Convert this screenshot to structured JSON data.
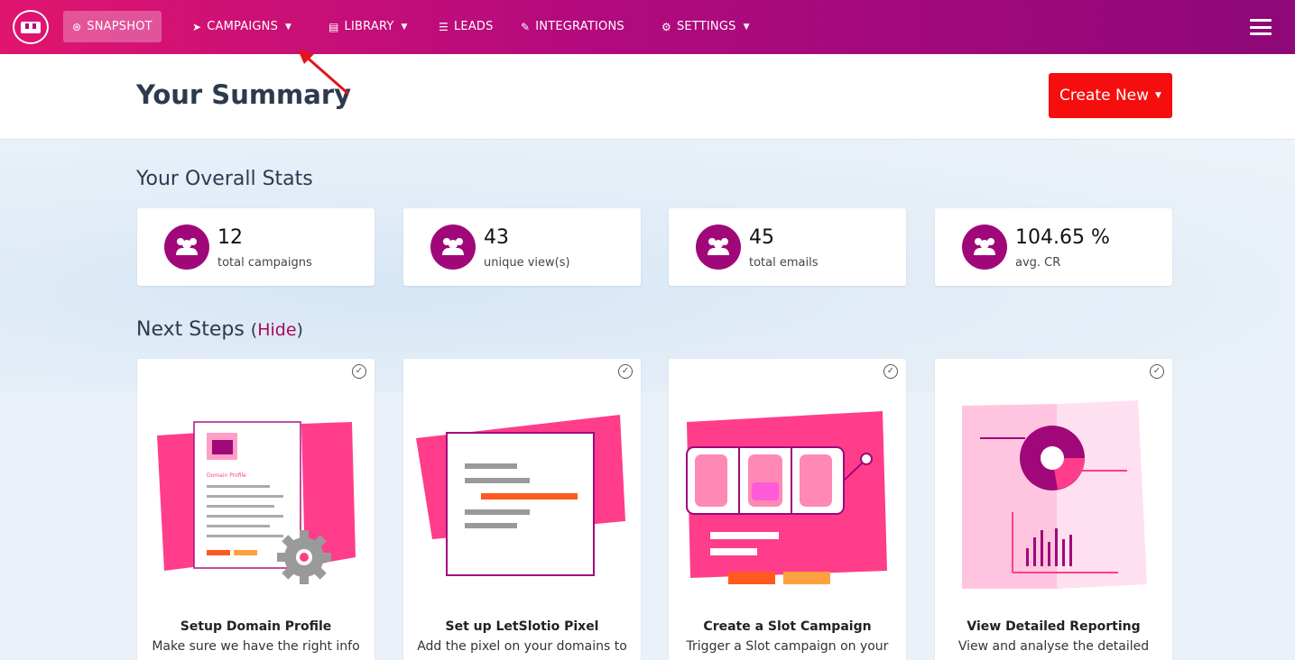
{
  "nav": {
    "items": [
      {
        "label": "SNAPSHOT",
        "icon": "dashboard-icon",
        "glyph": "⊛",
        "active": true
      },
      {
        "label": "CAMPAIGNS",
        "icon": "paper-plane-icon",
        "glyph": "➤",
        "dropdown": true
      },
      {
        "label": "LIBRARY",
        "icon": "library-icon",
        "glyph": "▤",
        "dropdown": true
      },
      {
        "label": "LEADS",
        "icon": "list-icon",
        "glyph": "☰"
      },
      {
        "label": "INTEGRATIONS",
        "icon": "plug-icon",
        "glyph": "✎"
      },
      {
        "label": "SETTINGS",
        "icon": "cogs-icon",
        "glyph": "⚙",
        "dropdown": true
      }
    ]
  },
  "header": {
    "title": "Your Summary",
    "create_button": "Create New"
  },
  "stats": {
    "title": "Your Overall Stats",
    "cards": [
      {
        "value": "12",
        "label": "total campaigns",
        "icon": "users-icon"
      },
      {
        "value": "43",
        "label": "unique view(s)",
        "icon": "users-icon"
      },
      {
        "value": "45",
        "label": "total emails",
        "icon": "users-icon"
      },
      {
        "value": "104.65 %",
        "label": "avg. CR",
        "icon": "users-icon"
      }
    ]
  },
  "next_steps": {
    "title": "Next Steps",
    "hide_label": "Hide",
    "cards": [
      {
        "title": "Setup Domain Profile",
        "desc": "Make sure we have the right info",
        "doc_text": "Domain Profile"
      },
      {
        "title": "Set up LetSlotio Pixel",
        "desc": "Add the pixel on your domains to"
      },
      {
        "title": "Create a Slot Campaign",
        "desc": "Trigger a Slot campaign on your"
      },
      {
        "title": "View Detailed Reporting",
        "desc": "View and analyse the detailed"
      }
    ]
  },
  "colors": {
    "brand": "#a0087a",
    "create_button": "#f60d0d",
    "accent_pink": "#ff3d8b"
  }
}
